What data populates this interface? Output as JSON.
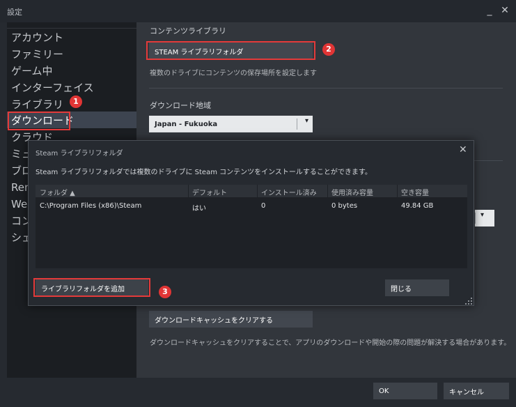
{
  "window": {
    "title": "設定",
    "minimize_glyph": "_",
    "close_glyph": "✕"
  },
  "sidebar": {
    "items": [
      {
        "label": "アカウント"
      },
      {
        "label": "ファミリー"
      },
      {
        "label": "ゲーム中"
      },
      {
        "label": "インターフェイス"
      },
      {
        "label": "ライブラリ"
      },
      {
        "label": "ダウンロード",
        "active": true
      },
      {
        "label": "クラウド"
      },
      {
        "label": "ミュ"
      },
      {
        "label": "ブロ"
      },
      {
        "label": "Rem"
      },
      {
        "label": "We"
      },
      {
        "label": "コン"
      },
      {
        "label": "シェ"
      }
    ]
  },
  "main": {
    "content_library": {
      "heading": "コンテンツライブラリ",
      "folders_button": "STEAM ライブラリフォルダ",
      "description": "複数のドライブにコンテンツの保存場所を設定します"
    },
    "download_region": {
      "heading": "ダウンロード地域",
      "selected": "Japan - Fukuoka"
    },
    "clear_cache": {
      "button": "ダウンロードキャッシュをクリアする",
      "description": "ダウンロードキャッシュをクリアすることで、アプリのダウンロードや開始の際の問題が解決する場合があります。"
    }
  },
  "modal": {
    "title": "Steam ライブラリフォルダ",
    "close_glyph": "✕",
    "description": "Steam ライブラリフォルダでは複数のドライブに Steam コンテンツをインストールすることができます。",
    "columns": [
      "フォルダ ▲",
      "デフォルト",
      "インストール済み",
      "使用済み容量",
      "空き容量"
    ],
    "rows": [
      {
        "folder": "C:\\Program Files (x86)\\Steam",
        "default": "はい",
        "installed": "0",
        "used": "0 bytes",
        "free": "49.84 GB"
      }
    ],
    "add_button": "ライブラリフォルダを追加",
    "close_button": "閉じる"
  },
  "footer": {
    "ok": "OK",
    "cancel": "キャンセル"
  },
  "annotations": {
    "badge1": "1",
    "badge2": "2",
    "badge3": "3"
  },
  "colors": {
    "highlight": "#e43a3a",
    "badge": "#e13535",
    "active_nav": "#3d4450"
  }
}
